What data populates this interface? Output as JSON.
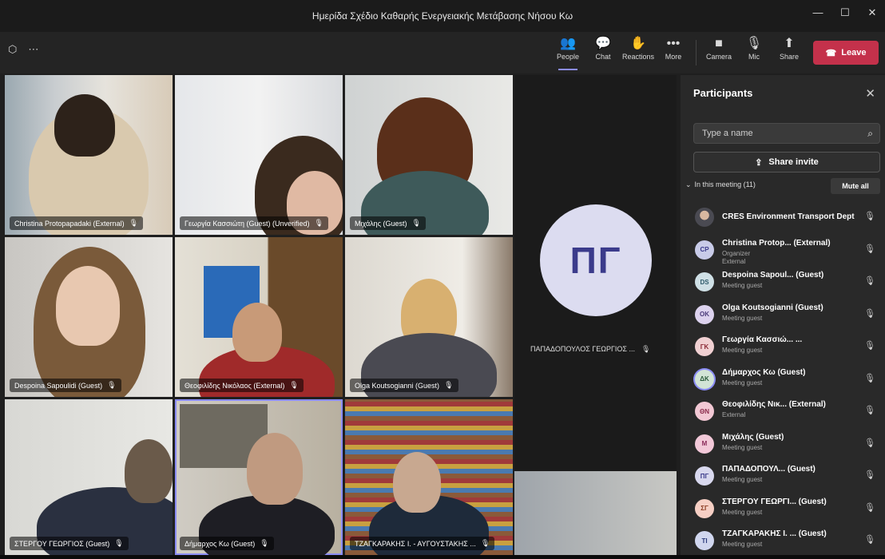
{
  "window": {
    "title": "Ημερίδα Σχέδιο Καθαρής Ενεργειακής Μετάβασης Νήσου Κω",
    "controls": [
      "—",
      "☐",
      "✕"
    ]
  },
  "toolbar": {
    "left_icons": [
      "shield-icon",
      "dots-icon"
    ],
    "left_glyphs": [
      "⬡",
      "⋯"
    ],
    "buttons": [
      {
        "label": "People",
        "glyph": "👥"
      },
      {
        "label": "Chat",
        "glyph": "💬"
      },
      {
        "label": "Reactions",
        "glyph": "✋"
      },
      {
        "label": "More",
        "glyph": "•••"
      },
      {
        "label": "Camera",
        "glyph": "■"
      },
      {
        "label": "Mic",
        "glyph": "🎙"
      },
      {
        "label": "Share",
        "glyph": "⬆"
      }
    ],
    "leave_label": "Leave",
    "leave_glyph": "☎",
    "leave_color": "#c4314b",
    "accent_color": "#8b8cf4"
  },
  "tiles": [
    {
      "label": "Christina Protopapadaki (External)"
    },
    {
      "label": "Γεωργία Κασσιώτη (Guest) (Unverified)"
    },
    {
      "label": "Μιχάλης (Guest)"
    },
    {
      "label": "Despoina Sapoulidi (Guest)"
    },
    {
      "label": "Θεοφιλίδης Νικόλαος (External)"
    },
    {
      "label": "Olga Koutsogianni (Guest)"
    },
    {
      "label": "ΣΤΕΡΓΟΥ ΓΕΩΡΓΙΟΣ (Guest)"
    },
    {
      "label": "Δήμαρχος Κω (Guest)"
    },
    {
      "label": "ΤΖΑΓΚΑΡΑΚΗΣ Ι. - ΑΥΓΟΥΣΤΑΚΗΣ ..."
    }
  ],
  "mic_off_glyph": "🎙",
  "big_tile": {
    "initials": "ΠΓ",
    "label": "ΠΑΠΑΔΟΠΟΥΛΟΣ ΓΕΩΡΓΙΟΣ ..."
  },
  "participants": {
    "title": "Participants",
    "close_glyph": "✕",
    "search_placeholder": "Type a name",
    "search_glyph": "⌕",
    "share_invite": "Share invite",
    "share_glyph": "⇪",
    "in_meeting": "In this meeting (11)",
    "chevron": "⌄",
    "mute_all": "Mute all",
    "list": [
      {
        "initials": "",
        "name": "CRES Environment Transport Dept",
        "sub": "",
        "mic": "🎙",
        "color": "#7a6a5a",
        "text_color": "#ffffff"
      },
      {
        "initials": "CP",
        "name": "Christina Protop... (External)",
        "sub": "Organizer\nExternal",
        "mic": "🎙",
        "color": "#c8cbe8",
        "text_color": "#3b3b8b"
      },
      {
        "initials": "DS",
        "name": "Despoina Sapoul... (Guest)",
        "sub": "Meeting guest",
        "mic": "🎙",
        "color": "#cfe0e6",
        "text_color": "#2e5a6a"
      },
      {
        "initials": "OK",
        "name": "Olga Koutsogianni (Guest)",
        "sub": "Meeting guest",
        "mic": "🎙",
        "color": "#dcd2ee",
        "text_color": "#4a3a7a"
      },
      {
        "initials": "ΓΚ",
        "name": "Γεωργία Κασσιώ... ...",
        "sub": "Meeting guest",
        "mic": "🎙",
        "color": "#f0d0d2",
        "text_color": "#8a2a36"
      },
      {
        "initials": "ΔΚ",
        "name": "Δήμαρχος Κω (Guest)",
        "sub": "Meeting guest",
        "mic": "🎙",
        "color": "#d2e4d6",
        "text_color": "#2a5a3a"
      },
      {
        "initials": "ΘΝ",
        "name": "Θεοφιλίδης Νικ... (External)",
        "sub": "External",
        "mic": "🎙",
        "color": "#f2c8d4",
        "text_color": "#8a2a4a"
      },
      {
        "initials": "M",
        "name": "Μιχάλης (Guest)",
        "sub": "Meeting guest",
        "mic": "🎙",
        "color": "#f2c8d8",
        "text_color": "#8a2a5a"
      },
      {
        "initials": "ΠΓ",
        "name": "ΠΑΠΑΔΟΠΟΥΛ... (Guest)",
        "sub": "Meeting guest",
        "mic": "🎙",
        "color": "#d8d8ee",
        "text_color": "#3b3b8b"
      },
      {
        "initials": "ΣΓ",
        "name": "ΣΤΕΡΓΟΥ ΓΕΩΡΓΙ... (Guest)",
        "sub": "Meeting guest",
        "mic": "🎙",
        "color": "#f6cfc4",
        "text_color": "#8a3a20"
      },
      {
        "initials": "ΤΙ",
        "name": "ΤΖΑΓΚΑΡΑΚΗΣ Ι. ... (Guest)",
        "sub": "Meeting guest",
        "mic": "🎙",
        "color": "#d0d6ee",
        "text_color": "#2a3a7a"
      }
    ]
  }
}
